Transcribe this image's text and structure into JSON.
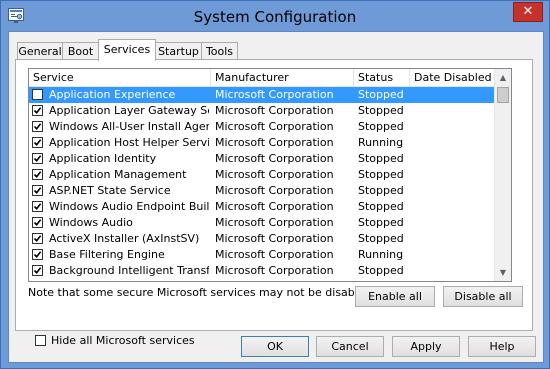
{
  "window": {
    "title": "System Configuration",
    "close_label": "✕"
  },
  "tabs": [
    {
      "label": "General"
    },
    {
      "label": "Boot"
    },
    {
      "label": "Services",
      "active": true
    },
    {
      "label": "Startup"
    },
    {
      "label": "Tools"
    }
  ],
  "list": {
    "columns": [
      "Service",
      "Manufacturer",
      "Status",
      "Date Disabled"
    ],
    "rows": [
      {
        "checked": false,
        "service": "Application Experience",
        "manufacturer": "Microsoft Corporation",
        "status": "Stopped",
        "date_disabled": "",
        "selected": true
      },
      {
        "checked": true,
        "service": "Application Layer Gateway Service",
        "manufacturer": "Microsoft Corporation",
        "status": "Stopped",
        "date_disabled": ""
      },
      {
        "checked": true,
        "service": "Windows All-User Install Agent",
        "manufacturer": "Microsoft Corporation",
        "status": "Stopped",
        "date_disabled": ""
      },
      {
        "checked": true,
        "service": "Application Host Helper Service",
        "manufacturer": "Microsoft Corporation",
        "status": "Running",
        "date_disabled": ""
      },
      {
        "checked": true,
        "service": "Application Identity",
        "manufacturer": "Microsoft Corporation",
        "status": "Stopped",
        "date_disabled": ""
      },
      {
        "checked": true,
        "service": "Application Management",
        "manufacturer": "Microsoft Corporation",
        "status": "Stopped",
        "date_disabled": ""
      },
      {
        "checked": true,
        "service": "ASP.NET State Service",
        "manufacturer": "Microsoft Corporation",
        "status": "Stopped",
        "date_disabled": ""
      },
      {
        "checked": true,
        "service": "Windows Audio Endpoint Builder",
        "manufacturer": "Microsoft Corporation",
        "status": "Stopped",
        "date_disabled": ""
      },
      {
        "checked": true,
        "service": "Windows Audio",
        "manufacturer": "Microsoft Corporation",
        "status": "Stopped",
        "date_disabled": ""
      },
      {
        "checked": true,
        "service": "ActiveX Installer (AxInstSV)",
        "manufacturer": "Microsoft Corporation",
        "status": "Stopped",
        "date_disabled": ""
      },
      {
        "checked": true,
        "service": "Base Filtering Engine",
        "manufacturer": "Microsoft Corporation",
        "status": "Running",
        "date_disabled": ""
      },
      {
        "checked": true,
        "service": "Background Intelligent Transfer ...",
        "manufacturer": "Microsoft Corporation",
        "status": "Stopped",
        "date_disabled": ""
      }
    ]
  },
  "note": "Note that some secure Microsoft services may not be disabled.",
  "buttons": {
    "enable_all": "Enable all",
    "disable_all": "Disable all",
    "ok": "OK",
    "cancel": "Cancel",
    "apply": "Apply",
    "help": "Help"
  },
  "hide_ms": {
    "label": "Hide all Microsoft services",
    "checked": false
  },
  "colors": {
    "title_bar": "#6e9bd8",
    "selection": "#3399ff",
    "close_button": "#c7312c"
  }
}
